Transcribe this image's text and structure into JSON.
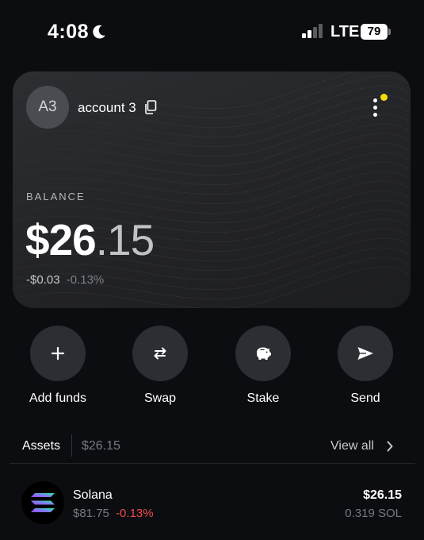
{
  "status_bar": {
    "time": "4:08",
    "network": "LTE",
    "battery_percent": "79",
    "icons": [
      "moon-icon",
      "signal-icon",
      "battery-icon"
    ]
  },
  "card": {
    "avatar_text": "A3",
    "account_name": "account 3",
    "balance_label": "BALANCE",
    "balance_int": "$26",
    "balance_dec": ".15",
    "change_amount": "-$0.03",
    "change_pct": "-0.13%",
    "notification_color": "#f5d90a",
    "icons": [
      "copy-icon",
      "more-vertical-icon"
    ]
  },
  "actions": [
    {
      "label": "Add funds",
      "icon": "plus-icon"
    },
    {
      "label": "Swap",
      "icon": "swap-icon"
    },
    {
      "label": "Stake",
      "icon": "piggy-bank-icon"
    },
    {
      "label": "Send",
      "icon": "send-icon"
    }
  ],
  "assets": {
    "title": "Assets",
    "total": "$26.15",
    "view_all": "View all",
    "items": [
      {
        "name": "Solana",
        "price": "$81.75",
        "change": "-0.13%",
        "value": "$26.15",
        "amount": "0.319 SOL",
        "icon": "solana-logo-icon"
      }
    ]
  },
  "colors": {
    "background": "#0c0d10",
    "card": "#26272b",
    "negative": "#ef4b4b",
    "muted": "#777a80"
  }
}
